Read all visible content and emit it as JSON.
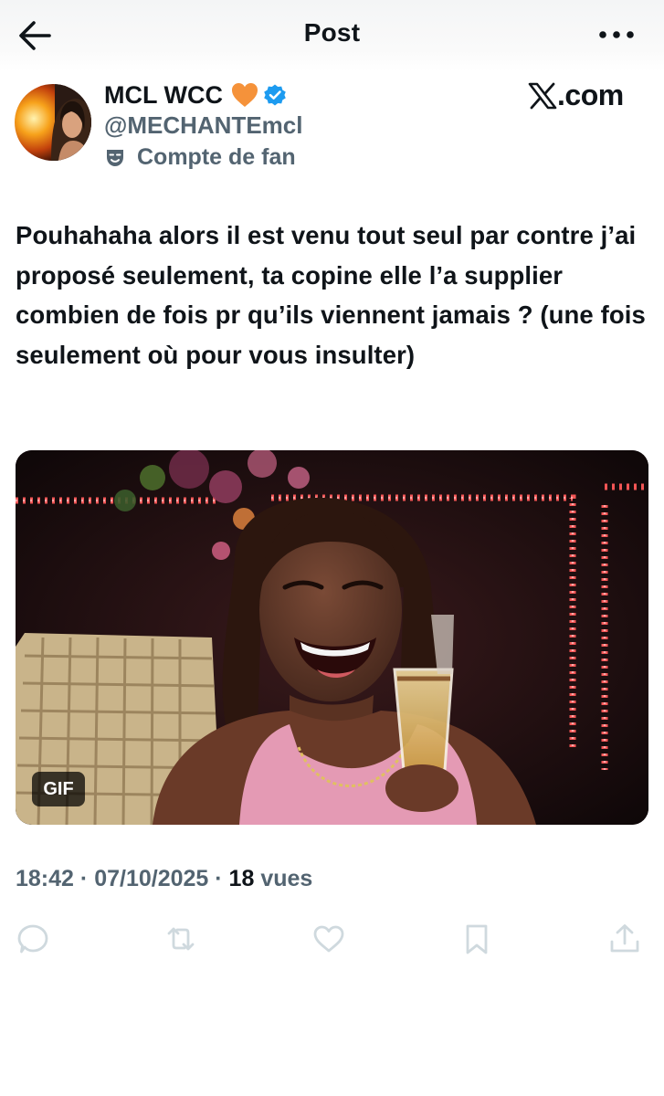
{
  "header": {
    "title": "Post",
    "back_icon": "arrow-left-icon",
    "more_icon": "more-horizontal-icon"
  },
  "author": {
    "display_name": "MCL WCC",
    "handle": "@MECHANTEmcl",
    "label": "Compte de fan",
    "heart_color": "#f5923a",
    "verified_color": "#1d9bf0"
  },
  "source": {
    "text": ".com"
  },
  "post": {
    "text": "Pouhahaha alors il est venu tout seul par contre j’ai proposé seulement, ta copine elle l’a supplier combien de fois pr qu’ils viennent jamais ? (une fois seulement où pour vous insulter)",
    "media": {
      "badge": "GIF"
    }
  },
  "meta": {
    "time": "18:42",
    "date": "07/10/2025",
    "views_count": "18",
    "views_label": "vues",
    "separator": "·"
  },
  "actions": [
    "reply-icon",
    "repost-icon",
    "like-icon",
    "bookmark-icon",
    "share-icon"
  ],
  "colors": {
    "text": "#0f1419",
    "secondary": "#536471",
    "action_icons": "#cfd9de"
  }
}
